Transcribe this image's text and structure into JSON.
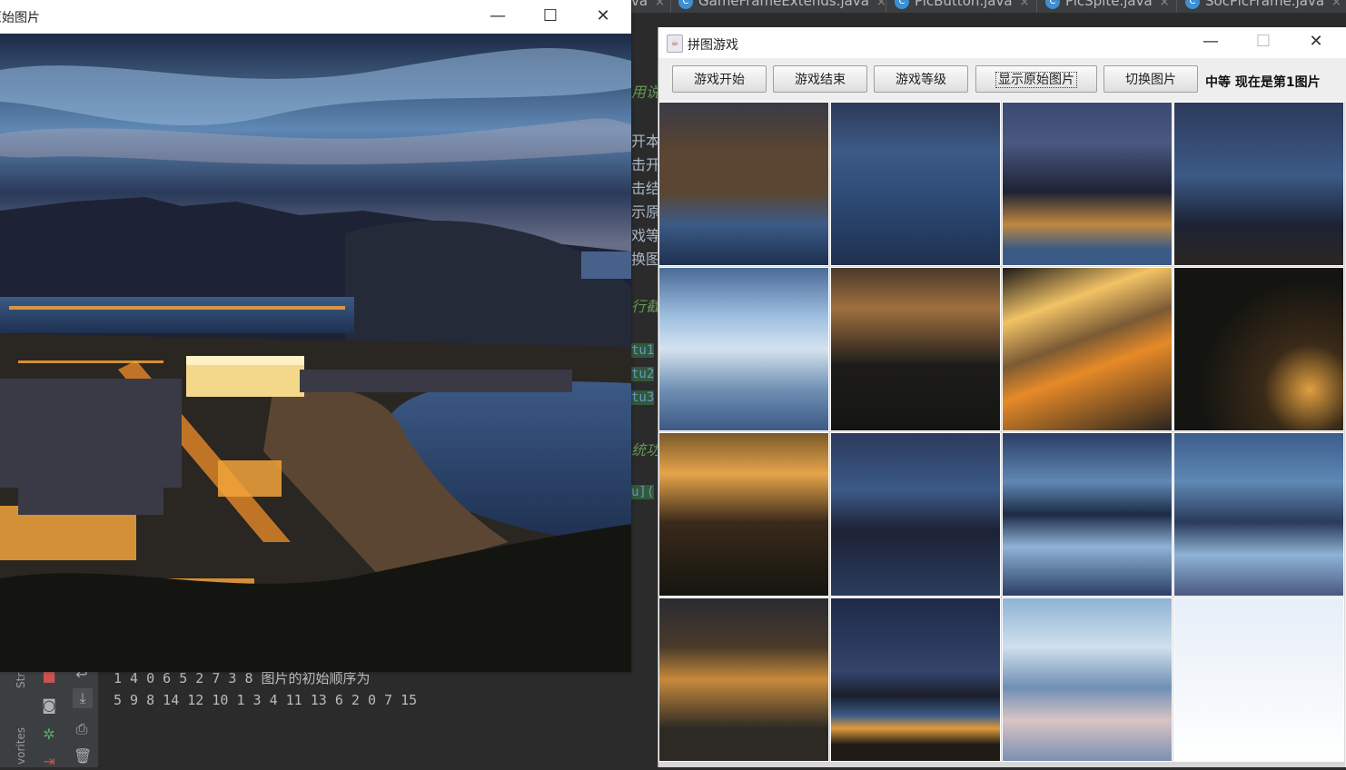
{
  "ide": {
    "tabs": [
      {
        "name": "va",
        "icon": "class-icon"
      },
      {
        "name": "GameFrameExtends.java",
        "icon": "class-icon"
      },
      {
        "name": "PicButton.java",
        "icon": "class-icon"
      },
      {
        "name": "PicSpite.java",
        "icon": "class-icon"
      },
      {
        "name": "SocPicFrame.java",
        "icon": "class-icon"
      }
    ],
    "code_fragments": [
      "用说",
      "开本",
      "击开",
      "击结",
      "示原",
      "戏等",
      "换图",
      "行截",
      "tu1",
      "tu2",
      "tu3",
      "统功",
      "u]("
    ],
    "console_lines": [
      "1 4 0 6 5 2 7 3 8 图片的初始顺序为",
      "5 9 8 14 12 10 1 3 4 11 13 6 2 0 7 15"
    ],
    "side_labels": [
      "Str",
      "vorites"
    ]
  },
  "original_window": {
    "title": "原始图片",
    "controls": [
      "minimize-icon",
      "maximize-icon",
      "close-icon"
    ]
  },
  "puzzle_window": {
    "title": "拼图游戏",
    "buttons": [
      "游戏开始",
      "游戏结束",
      "游戏等级",
      "显示原始图片",
      "切换图片"
    ],
    "status": "中等  现在是第1图片",
    "board": {
      "rows": 4,
      "cols": 4,
      "tiles": [
        "piece-5",
        "piece-9",
        "piece-8",
        "piece-14",
        "piece-12",
        "piece-10",
        "piece-1",
        "piece-3",
        "piece-4",
        "piece-11",
        "piece-13",
        "piece-6",
        "piece-2",
        "piece-0",
        "piece-7",
        "blank"
      ]
    }
  },
  "colors": {
    "sky_dark": "#1c2a45",
    "sky_light": "#8fb3d6",
    "city_light": "#f2a33a",
    "sea": "#2c4a74",
    "ide_bg": "#2b2b2b",
    "window_bg": "#f0f0f0"
  }
}
